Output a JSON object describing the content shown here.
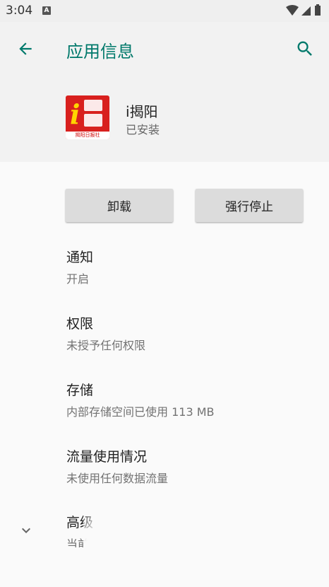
{
  "status_bar": {
    "time": "3:04",
    "notification_icon": "a-icon"
  },
  "header": {
    "title": "应用信息"
  },
  "app": {
    "name": "i揭阳",
    "status": "已安装",
    "icon_caption": "揭阳日报社"
  },
  "buttons": {
    "uninstall": "卸载",
    "force_stop": "强行停止"
  },
  "items": [
    {
      "title": "通知",
      "subtitle": "开启"
    },
    {
      "title": "权限",
      "subtitle": "未授予任何权限"
    },
    {
      "title": "存储",
      "subtitle": "内部存储空间已使用 113 MB"
    },
    {
      "title": "流量使用情况",
      "subtitle": "未使用任何数据流量"
    },
    {
      "title": "高级",
      "subtitle": "当前"
    }
  ],
  "colors": {
    "accent": "#00796b",
    "header_bg": "#f2f2f2",
    "icon_red": "#d8201e"
  }
}
